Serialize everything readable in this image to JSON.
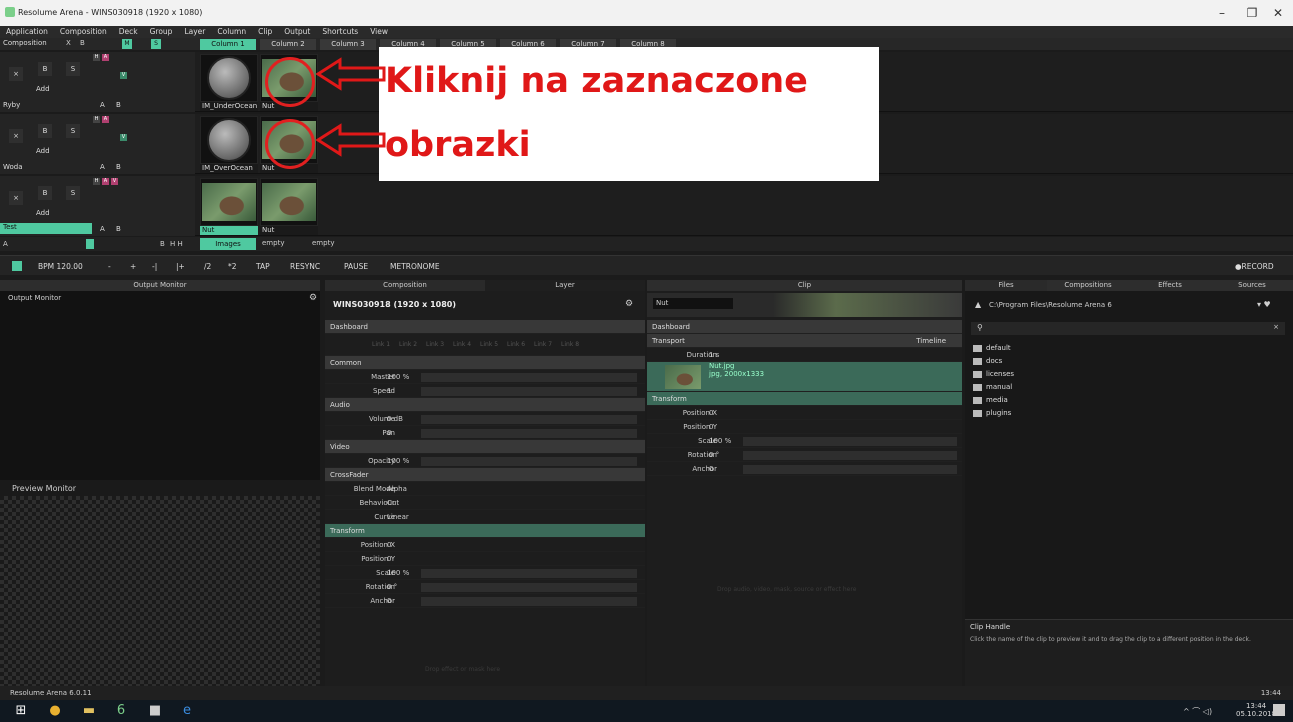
{
  "window": {
    "title": "Resolume Arena - WINS030918 (1920 x 1080)",
    "min": "–",
    "max": "❐",
    "close": "✕"
  },
  "menu": [
    "Application",
    "Composition",
    "Deck",
    "Group",
    "Layer",
    "Column",
    "Clip",
    "Output",
    "Shortcuts",
    "View"
  ],
  "compbar": {
    "label": "Composition",
    "x": "X",
    "b": "B",
    "m": "M",
    "s": "S"
  },
  "columns": [
    "Column 1",
    "Column 2",
    "Column 3",
    "Column 4",
    "Column 5",
    "Column 6",
    "Column 7",
    "Column 8"
  ],
  "layers": [
    {
      "name": "Ryby",
      "add": "Add",
      "a": "A",
      "b": "B",
      "clip1": "IM_UnderOcean",
      "clip2": "Nut"
    },
    {
      "name": "Woda",
      "add": "Add",
      "a": "A",
      "b": "B",
      "clip1": "IM_OverOcean",
      "clip2": "Nut"
    },
    {
      "name": "Test",
      "add": "Add",
      "a": "A",
      "b": "B",
      "clip1": "Nut",
      "clip2": "Nut"
    }
  ],
  "layer_btns": {
    "x": "×",
    "b": "B",
    "s": "S",
    "h": "H",
    "av": "A",
    "v": "V"
  },
  "deckrow": {
    "a": "A",
    "b": "B",
    "ctrl": "H  H",
    "decks": [
      "Images",
      "empty",
      "empty"
    ]
  },
  "annotation": {
    "line1": "Kliknij na zaznaczone",
    "line2": "obrazki"
  },
  "toolbar": {
    "bpm": "BPM 120.00",
    "minus": "-",
    "plus": "+",
    "nudge1": "-|",
    "nudge2": "|+",
    "div": "/2",
    "mul": "*2",
    "tap": "TAP",
    "resync": "RESYNC",
    "pause": "PAUSE",
    "metronome": "METRONOME",
    "record": "●RECORD"
  },
  "output": {
    "head": "Output Monitor",
    "title": "Output Monitor",
    "preview": "Preview Monitor"
  },
  "layerpanel": {
    "tabs": [
      "Composition",
      "Layer"
    ],
    "title": "WINS030918 (1920 x 1080)",
    "dashboard": "Dashboard",
    "links": [
      "Link 1",
      "Link 2",
      "Link 3",
      "Link 4",
      "Link 5",
      "Link 6",
      "Link 7",
      "Link 8"
    ],
    "common": "Common",
    "master_l": "Master",
    "master_v": "100 %",
    "speed_l": "Speed",
    "speed_v": "1",
    "audio": "Audio",
    "volume_l": "Volume",
    "volume_v": "0 dB",
    "pan_l": "Pan",
    "pan_v": "0",
    "video": "Video",
    "opacity_l": "Opacity",
    "opacity_v": "100 %",
    "crossfader": "CrossFader",
    "blend_l": "Blend Mode",
    "blend_v": "Alpha",
    "behaviour_l": "Behaviour",
    "behaviour_v": "Cut",
    "curve_l": "Curve",
    "curve_v": "Linear",
    "transform": "Transform",
    "posx_l": "Position X",
    "posx_v": "0",
    "posy_l": "Position Y",
    "posy_v": "0",
    "scale_l": "Scale",
    "scale_v": "100 %",
    "rotation_l": "Rotation",
    "rotation_v": "0 °",
    "anchor_l": "Anchor",
    "anchor_v": "0",
    "drop": "Drop effect or mask here"
  },
  "clippanel": {
    "head": "Clip",
    "name": "Nut",
    "dashboard": "Dashboard",
    "transport": "Transport",
    "timeline": "Timeline",
    "duration_l": "Duration",
    "duration_v": "1 s",
    "file": "Nut.jpg",
    "filemeta": "jpg, 2000x1333",
    "transform": "Transform",
    "posx_l": "Position X",
    "posx_v": "0",
    "posy_l": "Position Y",
    "posy_v": "0",
    "scale_l": "Scale",
    "scale_v": "100 %",
    "rotation_l": "Rotation",
    "rotation_v": "0 °",
    "anchor_l": "Anchor",
    "anchor_v": "0",
    "drop": "Drop audio, video, mask, source or effect here"
  },
  "files": {
    "tabs": [
      "Files",
      "Compositions",
      "Effects",
      "Sources"
    ],
    "path": "C:\\Program Files\\Resolume Arena 6",
    "folders": [
      "default",
      "docs",
      "licenses",
      "manual",
      "media",
      "plugins"
    ],
    "handle_title": "Clip Handle",
    "handle_text": "Click the name of the clip to preview it and to drag the clip to a different position in the deck."
  },
  "status": {
    "left": "Resolume Arena 6.0.11",
    "right": "13:44"
  },
  "taskbar": {
    "time": "13:44",
    "date": "05.10.2018"
  },
  "colors": {
    "accent": "#4fc9a0",
    "annotation": "#e01818"
  }
}
